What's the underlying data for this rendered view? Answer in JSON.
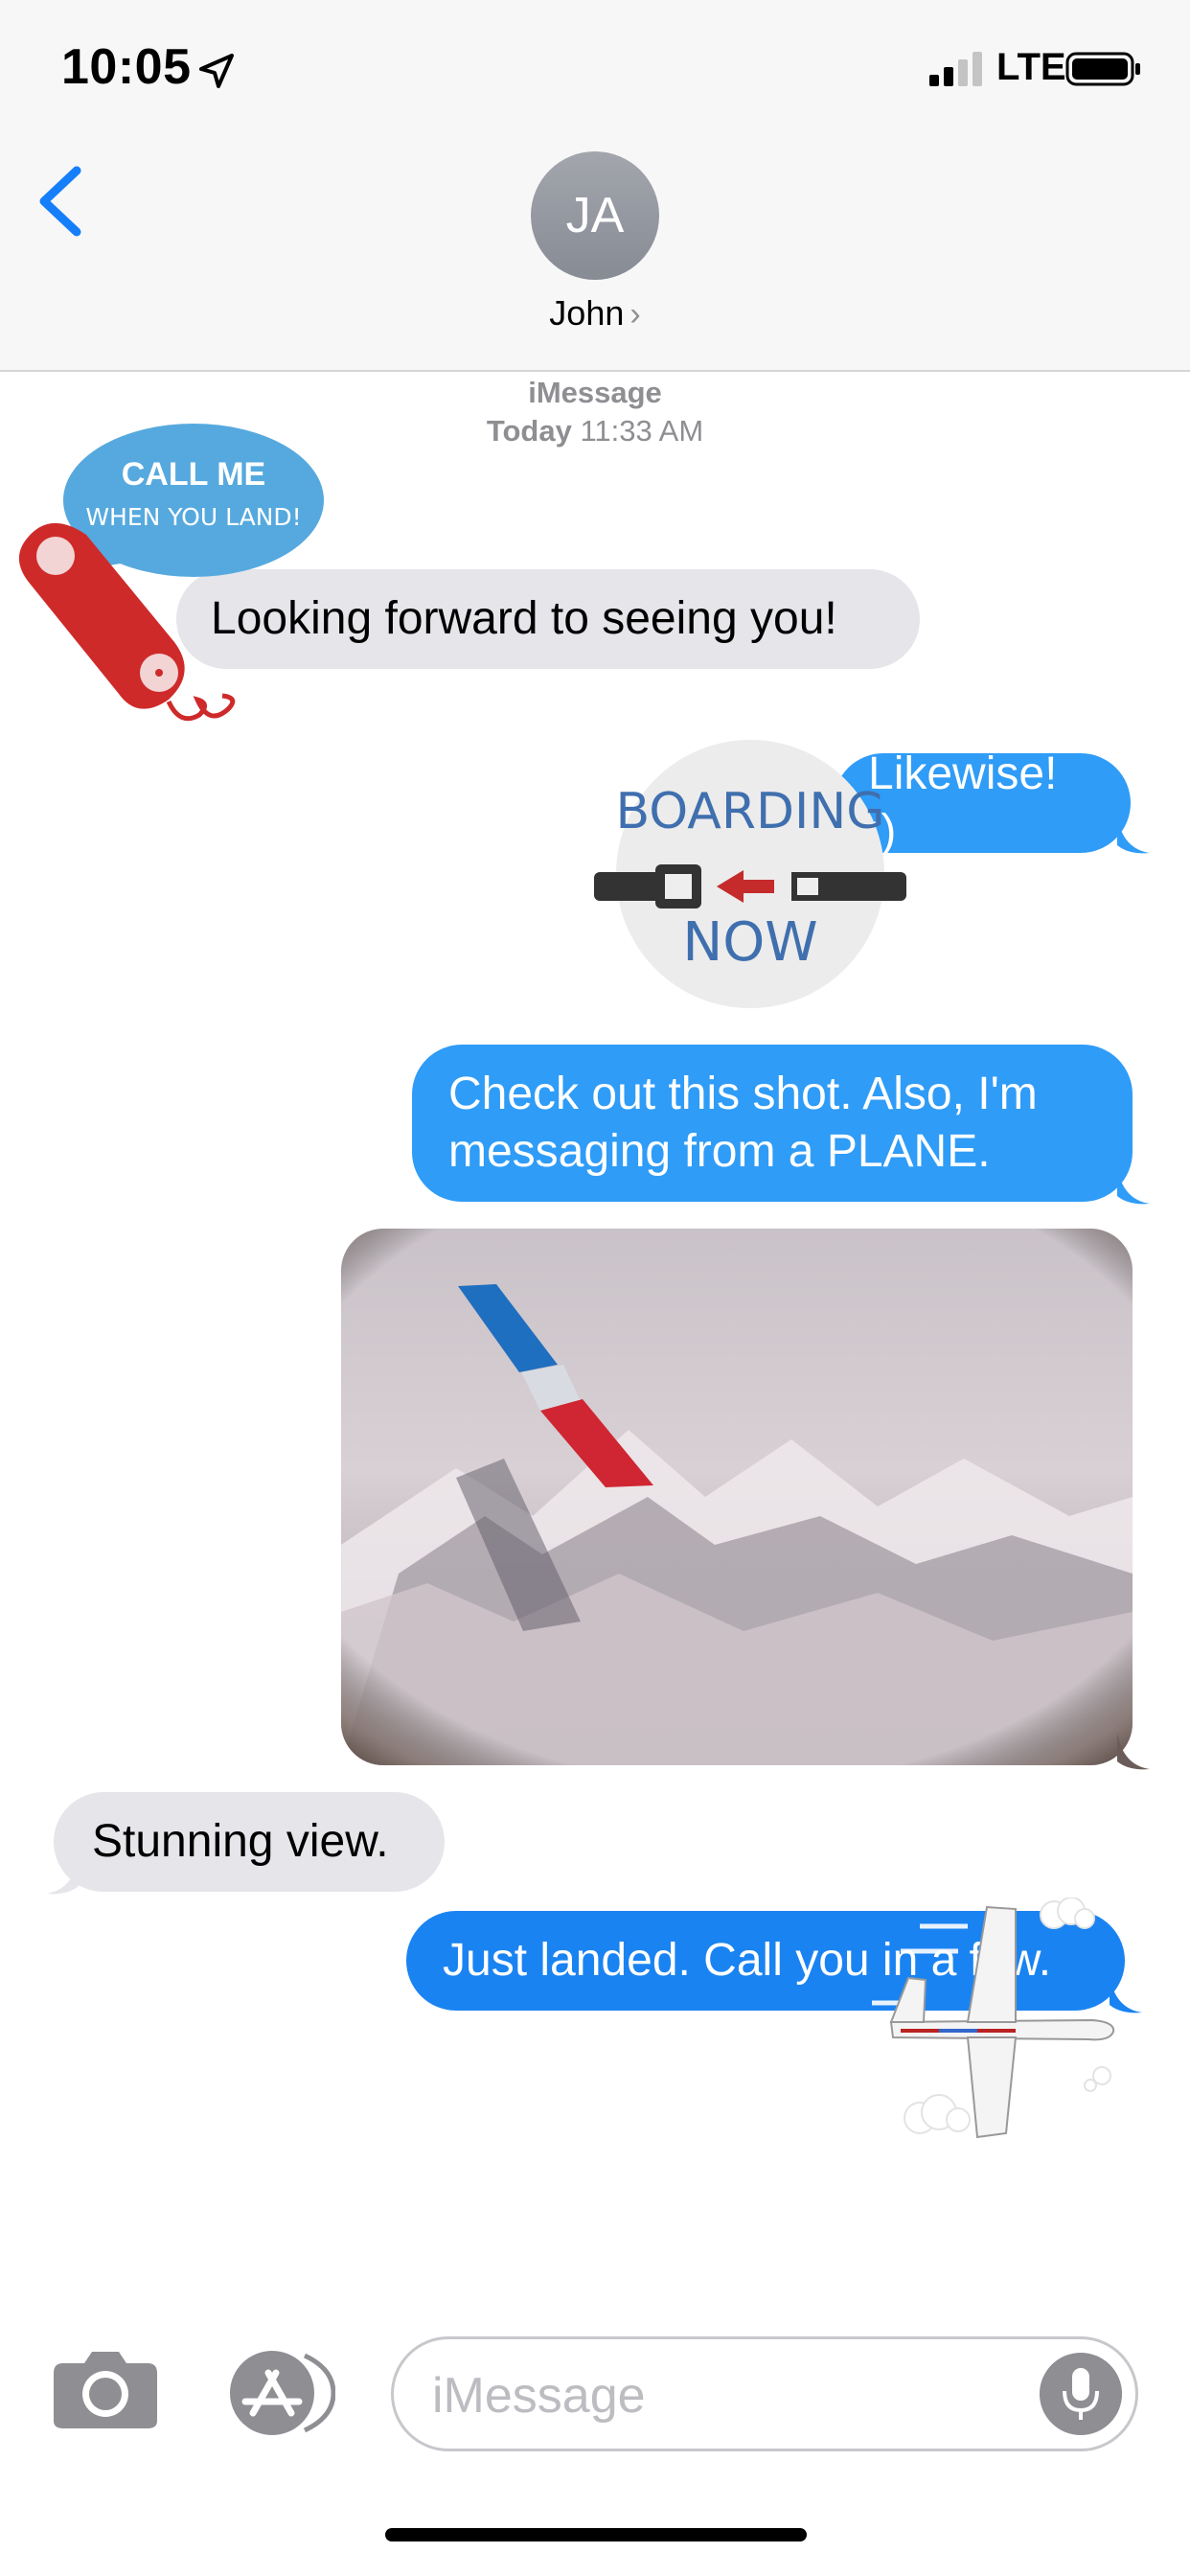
{
  "status_bar": {
    "time": "10:05",
    "network": "LTE"
  },
  "header": {
    "avatar_initials": "JA",
    "contact_name": "John",
    "chevron": "›"
  },
  "conversation": {
    "service": "iMessage",
    "timestamp_day": "Today",
    "timestamp_time": "11:33 AM",
    "messages": [
      {
        "from": "them",
        "text": "Looking forward to seeing you!"
      },
      {
        "from": "me",
        "text": "Likewise! :)"
      },
      {
        "from": "me",
        "text": "Check out this shot. Also, I'm messaging from a PLANE."
      },
      {
        "from": "me",
        "type": "photo",
        "description": "airplane-window-photo"
      },
      {
        "from": "them",
        "text": "Stunning view."
      },
      {
        "from": "me",
        "text": "Just landed. Call you in a few."
      }
    ],
    "stickers": {
      "call_line1": "CALL ME",
      "call_line2": "WHEN YOU LAND!",
      "boarding_line1": "BOARDING",
      "boarding_line2": "NOW"
    }
  },
  "composer": {
    "placeholder": "iMessage"
  },
  "colors": {
    "accent": "#2f9cf7",
    "incoming": "#e5e5ea",
    "back_blue": "#157efb"
  }
}
